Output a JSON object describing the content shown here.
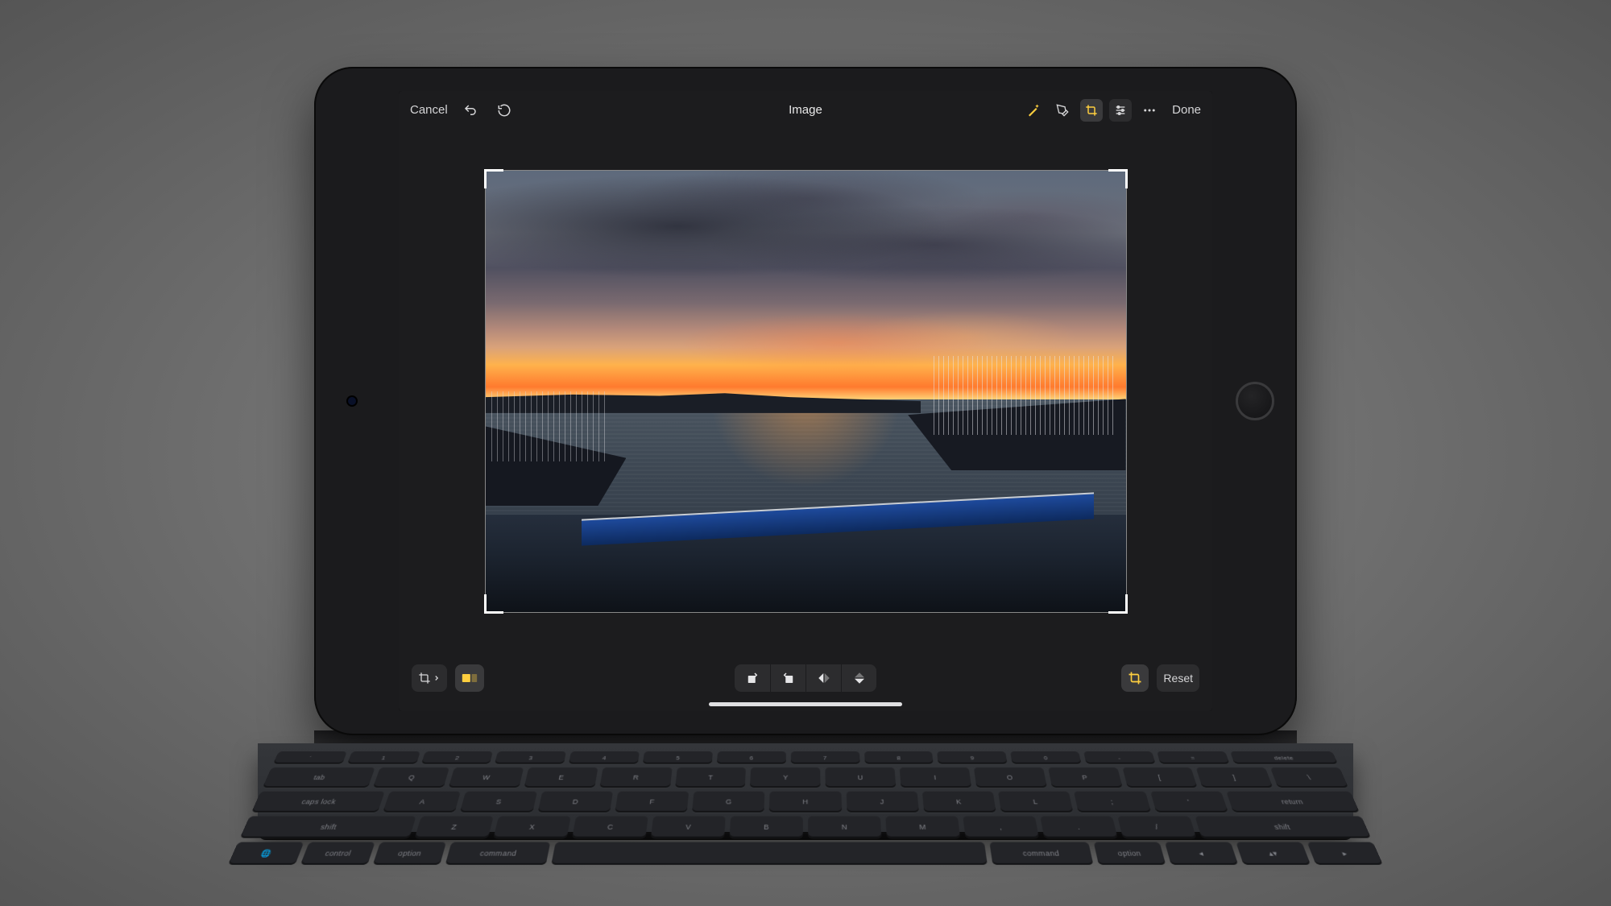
{
  "header": {
    "cancel_label": "Cancel",
    "title": "Image",
    "done_label": "Done",
    "icons": {
      "undo": "undo-icon",
      "redo": "redo-icon",
      "auto_enhance": "wand-icon",
      "markup": "pen-icon",
      "crop": "crop-icon",
      "filters": "filters-icon",
      "more": "more-icon"
    },
    "crop_active": true
  },
  "bottombar": {
    "aspect_label": "",
    "reset_label": "Reset",
    "presets_active": true,
    "tools": {
      "aspect_menu": "aspect-ratio-icon",
      "presets": "presets-icon",
      "rotate_left": "rotate-left-icon",
      "rotate_right": "rotate-right-icon",
      "flip_h": "flip-horizontal-icon",
      "flip_v": "flip-vertical-icon",
      "auto_crop": "auto-crop-icon"
    }
  },
  "colors": {
    "accent": "#ffcf3f",
    "panel": "#1c1c1e",
    "button": "#2c2c2e"
  },
  "image": {
    "description": "Sunset over a marina with boats, dramatic clouds, orange horizon glow reflected on water"
  }
}
